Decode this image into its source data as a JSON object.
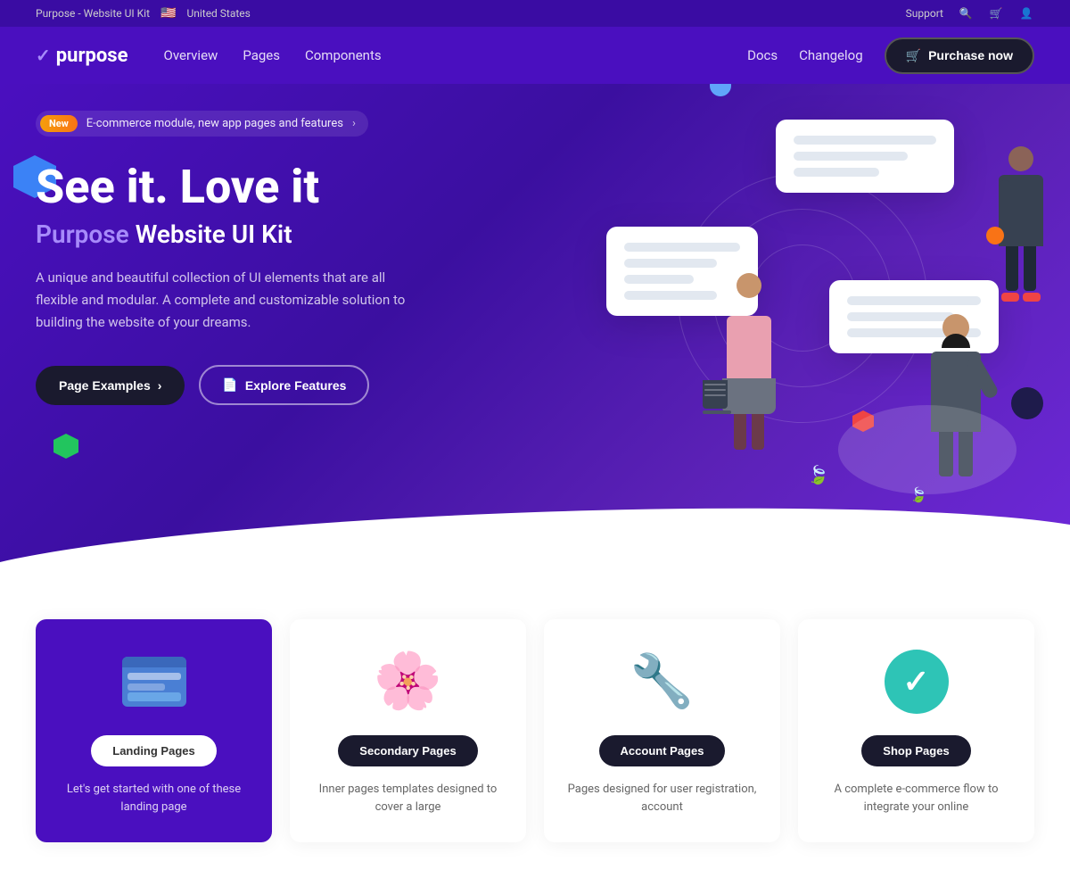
{
  "topbar": {
    "brand": "Purpose - Website UI Kit",
    "region": "United States",
    "flag": "🇺🇸",
    "support": "Support"
  },
  "navbar": {
    "logo_text": "purpose",
    "links": [
      "Overview",
      "Pages",
      "Components"
    ],
    "right_links": [
      "Docs",
      "Changelog"
    ],
    "purchase_btn": "Purchase now"
  },
  "announcement": {
    "badge": "New",
    "text": "E-commerce module, new app pages and features",
    "arrow": "›"
  },
  "hero": {
    "title_line1": "See it. Love it",
    "title_line2_prefix": "Purpose",
    "title_line2_suffix": " Website UI Kit",
    "description": "A unique and beautiful collection of UI elements that are all flexible and modular. A complete and customizable solution to building the website of your dreams.",
    "btn_primary": "Page Examples",
    "btn_secondary": "Explore Features"
  },
  "feature_cards": [
    {
      "label": "Landing Pages",
      "description": "Let's get started with one of these landing page",
      "type": "landing"
    },
    {
      "label": "Secondary Pages",
      "description": "Inner pages templates designed to cover a large",
      "type": "secondary"
    },
    {
      "label": "Account Pages",
      "description": "Pages designed for user registration, account",
      "type": "account"
    },
    {
      "label": "Shop Pages",
      "description": "A complete e-commerce flow to integrate your online",
      "type": "shop"
    }
  ]
}
